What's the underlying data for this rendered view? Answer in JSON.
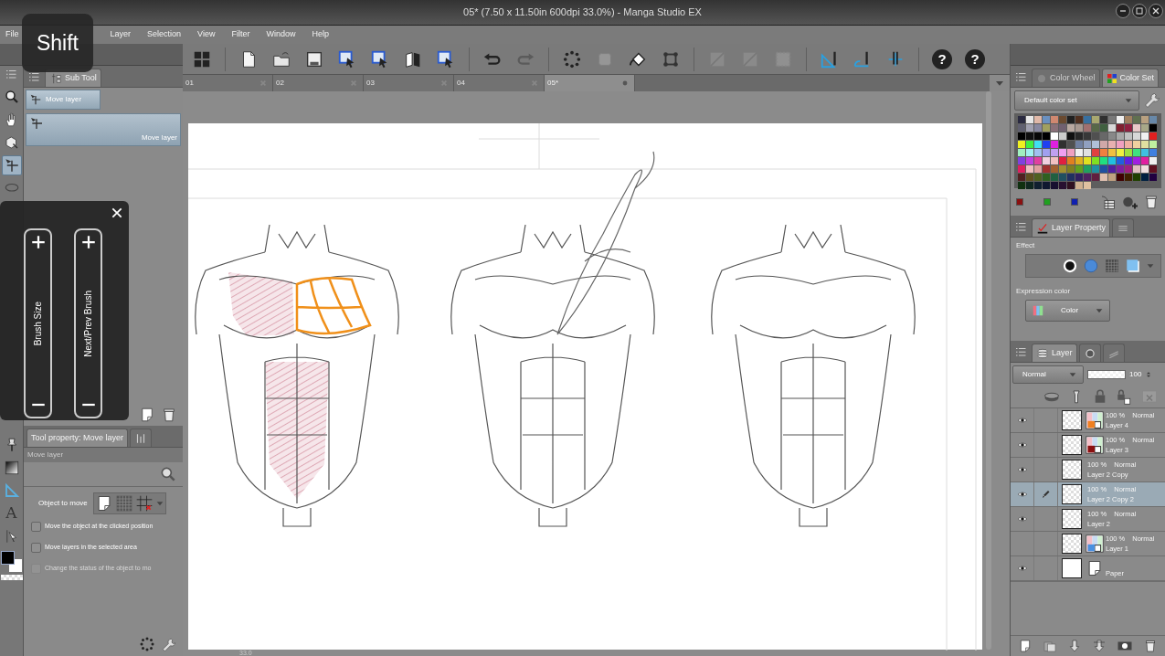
{
  "window": {
    "title": "05* (7.50 x 11.50in 600dpi 33.0%) - Manga Studio EX"
  },
  "key_overlay": {
    "label": "Shift"
  },
  "menu": [
    "File",
    "Layer",
    "Selection",
    "View",
    "Filter",
    "Window",
    "Help"
  ],
  "toolbar": [
    {
      "kind": "grid",
      "disabled": false
    },
    {
      "kind": "separator"
    },
    {
      "kind": "new",
      "disabled": false
    },
    {
      "kind": "open",
      "disabled": false
    },
    {
      "kind": "save",
      "disabled": false
    },
    {
      "kind": "export",
      "disabled": false
    },
    {
      "kind": "export",
      "disabled": false
    },
    {
      "kind": "book",
      "disabled": false
    },
    {
      "kind": "export",
      "disabled": false
    },
    {
      "kind": "separator"
    },
    {
      "kind": "undo",
      "disabled": false
    },
    {
      "kind": "redo",
      "disabled": true
    },
    {
      "kind": "separator"
    },
    {
      "kind": "dots",
      "disabled": false
    },
    {
      "kind": "block",
      "disabled": true
    },
    {
      "kind": "bucket",
      "disabled": false
    },
    {
      "kind": "transform",
      "disabled": false
    },
    {
      "kind": "separator"
    },
    {
      "kind": "slash",
      "disabled": true
    },
    {
      "kind": "slash",
      "disabled": true
    },
    {
      "kind": "frame",
      "disabled": true
    },
    {
      "kind": "separator"
    },
    {
      "kind": "ruler",
      "disabled": false
    },
    {
      "kind": "ruler2",
      "disabled": false
    },
    {
      "kind": "ruler3",
      "disabled": false
    },
    {
      "kind": "separator"
    },
    {
      "kind": "help",
      "label": "?",
      "disabled": false
    },
    {
      "kind": "help",
      "label": "?",
      "disabled": false
    }
  ],
  "doc_tabs": [
    {
      "label": "01",
      "selected": false
    },
    {
      "label": "02",
      "selected": false
    },
    {
      "label": "03",
      "selected": false
    },
    {
      "label": "04",
      "selected": false
    },
    {
      "label": "05*",
      "selected": true
    }
  ],
  "tools": [
    {
      "kind": "zoom",
      "selected": false
    },
    {
      "kind": "hand",
      "selected": false
    },
    {
      "kind": "object",
      "selected": false
    },
    {
      "kind": "move",
      "selected": true
    },
    {
      "kind": "lasso",
      "selected": false
    },
    {
      "kind": "spacer"
    },
    {
      "kind": "pin",
      "selected": false
    },
    {
      "kind": "gradient",
      "selected": false
    },
    {
      "kind": "triangle",
      "selected": false
    },
    {
      "kind": "text",
      "label": "A",
      "selected": false
    },
    {
      "kind": "pointer",
      "selected": false
    }
  ],
  "colors": [
    {
      "kind": "main",
      "color": "#000000"
    },
    {
      "kind": "sub",
      "color": "#ffffff"
    }
  ],
  "sub_tool": {
    "tab": "Sub Tool",
    "groups": [
      {
        "label": "Move layer",
        "selected": true
      }
    ],
    "items": [
      {
        "label": "Move layer",
        "selected": true
      }
    ]
  },
  "brush_overlay": {
    "sliders": [
      {
        "label": "Brush Size"
      },
      {
        "label": "Next/Prev Brush"
      }
    ]
  },
  "tool_property": {
    "tab": "Tool property: Move layer",
    "title": "Move layer",
    "object_label": "Object to move",
    "options": [
      {
        "label": "Move the object at the clicked position",
        "checked": false,
        "disabled": false
      },
      {
        "label": "Move layers in the selected area",
        "checked": false,
        "disabled": false
      },
      {
        "label": "Change the status of the object to mo",
        "checked": false,
        "disabled": true
      }
    ]
  },
  "color_panel": {
    "tabs": [
      {
        "label": "Color Wheel",
        "selected": false
      },
      {
        "label": "Color Set",
        "selected": true
      }
    ],
    "set_name": "Default color set",
    "palette": [
      {
        "color": "#2a2a40"
      },
      {
        "color": "#e8e8e8"
      },
      {
        "color": "#e0b8a8"
      },
      {
        "color": "#6a90c0"
      },
      {
        "color": "#d08870"
      },
      {
        "color": "#6a4a30"
      },
      {
        "color": "#202020"
      },
      {
        "color": "#503020"
      },
      {
        "color": "#3870a0"
      },
      {
        "color": "#a8a870"
      },
      {
        "color": "#303030"
      },
      {
        "color": "#787878"
      },
      {
        "color": "#f0f0f0"
      },
      {
        "color": "#a08060"
      },
      {
        "color": "#607050"
      },
      {
        "color": "#b8a080"
      },
      {
        "color": "#6888a8"
      },
      {
        "color": "#606070"
      },
      {
        "color": "#a0a0b0"
      },
      {
        "color": "#8888a0"
      },
      {
        "color": "#a0a060"
      },
      {
        "color": "#8a7078"
      },
      {
        "color": "#706070"
      },
      {
        "color": "#b8a8a0"
      },
      {
        "color": "#a89890"
      },
      {
        "color": "#a07070"
      },
      {
        "color": "#586848"
      },
      {
        "color": "#406040"
      },
      {
        "color": "#d8d8d8"
      },
      {
        "color": "#802030"
      },
      {
        "color": "#902040"
      },
      {
        "color": "#e8c8c8"
      },
      {
        "color": "#a8a888"
      },
      {
        "color": "#000000"
      },
      {
        "color": "#000000"
      },
      {
        "color": "#101010"
      },
      {
        "color": "#080808"
      },
      {
        "color": "#000000"
      },
      {
        "color": "#ffffff"
      },
      {
        "color": "#cccccc"
      },
      {
        "color": "#101010"
      },
      {
        "color": "#282828"
      },
      {
        "color": "#383838"
      },
      {
        "color": "#505050"
      },
      {
        "color": "#686868"
      },
      {
        "color": "#888888"
      },
      {
        "color": "#a8a8a8"
      },
      {
        "color": "#c0c0c0"
      },
      {
        "color": "#d8d8d8"
      },
      {
        "color": "#f0f0f0"
      },
      {
        "color": "#e02020"
      },
      {
        "color": "#f0f020"
      },
      {
        "color": "#40f040"
      },
      {
        "color": "#40e0f0"
      },
      {
        "color": "#2040f0"
      },
      {
        "color": "#e020e0"
      },
      {
        "color": "#303030"
      },
      {
        "color": "#505050"
      },
      {
        "color": "#7080a0"
      },
      {
        "color": "#90a0c0"
      },
      {
        "color": "#b0c0d8"
      },
      {
        "color": "#d0a8a8"
      },
      {
        "color": "#e8b0b0"
      },
      {
        "color": "#f0a0c0"
      },
      {
        "color": "#f0b0a0"
      },
      {
        "color": "#f0d0a0"
      },
      {
        "color": "#e0e0a0"
      },
      {
        "color": "#c0f0a0"
      },
      {
        "color": "#a0f0c0"
      },
      {
        "color": "#a0f0f0"
      },
      {
        "color": "#a0c0f0"
      },
      {
        "color": "#a0a0f0"
      },
      {
        "color": "#c0a0f0"
      },
      {
        "color": "#f0a0f0"
      },
      {
        "color": "#f0a0c0"
      },
      {
        "color": "#f0f0f0"
      },
      {
        "color": "#e0e0e0"
      },
      {
        "color": "#e04040"
      },
      {
        "color": "#f08040"
      },
      {
        "color": "#f0c040"
      },
      {
        "color": "#f0f040"
      },
      {
        "color": "#a0e040"
      },
      {
        "color": "#40e080"
      },
      {
        "color": "#40c0e0"
      },
      {
        "color": "#4080e0"
      },
      {
        "color": "#8040e0"
      },
      {
        "color": "#c040e0"
      },
      {
        "color": "#e040a0"
      },
      {
        "color": "#f0d0e0"
      },
      {
        "color": "#f0c0c0"
      },
      {
        "color": "#e02040"
      },
      {
        "color": "#e08020"
      },
      {
        "color": "#e0b020"
      },
      {
        "color": "#e0e020"
      },
      {
        "color": "#80e020"
      },
      {
        "color": "#20e080"
      },
      {
        "color": "#20c0e0"
      },
      {
        "color": "#2060e0"
      },
      {
        "color": "#6020e0"
      },
      {
        "color": "#a020e0"
      },
      {
        "color": "#e020a0"
      },
      {
        "color": "#f0f0f0"
      },
      {
        "color": "#e02060"
      },
      {
        "color": "#f0c0c0"
      },
      {
        "color": "#e0a0a0"
      },
      {
        "color": "#a03030"
      },
      {
        "color": "#a06030"
      },
      {
        "color": "#a09030"
      },
      {
        "color": "#808020"
      },
      {
        "color": "#60a020"
      },
      {
        "color": "#20a060"
      },
      {
        "color": "#2090a0"
      },
      {
        "color": "#2050a0"
      },
      {
        "color": "#5020a0"
      },
      {
        "color": "#8020a0"
      },
      {
        "color": "#a02080"
      },
      {
        "color": "#e0c0c0"
      },
      {
        "color": "#f0e0e0"
      },
      {
        "color": "#601020"
      },
      {
        "color": "#502020"
      },
      {
        "color": "#605020"
      },
      {
        "color": "#506020"
      },
      {
        "color": "#306020"
      },
      {
        "color": "#206040"
      },
      {
        "color": "#205060"
      },
      {
        "color": "#203060"
      },
      {
        "color": "#302060"
      },
      {
        "color": "#502060"
      },
      {
        "color": "#602040"
      },
      {
        "color": "#e0c0b0"
      },
      {
        "color": "#c0a080"
      },
      {
        "color": "#400000"
      },
      {
        "color": "#402000"
      },
      {
        "color": "#204000"
      },
      {
        "color": "#002040"
      },
      {
        "color": "#200040"
      },
      {
        "color": "#103010"
      },
      {
        "color": "#102820"
      },
      {
        "color": "#102030"
      },
      {
        "color": "#101830"
      },
      {
        "color": "#181030"
      },
      {
        "color": "#281030"
      },
      {
        "color": "#301020"
      },
      {
        "color": "#d0b090"
      },
      {
        "color": "#e0c0a0"
      }
    ],
    "recent": [
      {
        "color": "#8a1010"
      },
      {
        "color": "#20a020"
      },
      {
        "color": "#1020b0"
      }
    ]
  },
  "layer_property": {
    "tabs": [
      {
        "label": "Layer Property",
        "selected": true
      }
    ],
    "effect_label": "Effect",
    "expression_label": "Expression color",
    "expression_value": "Color"
  },
  "layers_panel": {
    "tab": "Layer",
    "blend": "Normal",
    "opacity": "100",
    "level": 1,
    "layers": [
      {
        "kind": "color",
        "name": "Layer 4",
        "opacity": "100 %",
        "blend": "Normal",
        "visible": true,
        "editing": false,
        "selected": false,
        "color": "#f08020"
      },
      {
        "kind": "color",
        "name": "Layer 3",
        "opacity": "100 %",
        "blend": "Normal",
        "visible": true,
        "editing": false,
        "selected": false,
        "color": "#8a1010"
      },
      {
        "kind": "raster",
        "name": "Layer 2 Copy",
        "opacity": "100 %",
        "blend": "Normal",
        "visible": true,
        "editing": false,
        "selected": false
      },
      {
        "kind": "raster",
        "name": "Layer 2 Copy 2",
        "opacity": "100 %",
        "blend": "Normal",
        "visible": true,
        "editing": true,
        "selected": true
      },
      {
        "kind": "raster",
        "name": "Layer 2",
        "opacity": "100 %",
        "blend": "Normal",
        "visible": true,
        "editing": false,
        "selected": false
      },
      {
        "kind": "color",
        "name": "Layer 1",
        "opacity": "100 %",
        "blend": "Normal",
        "visible": false,
        "editing": false,
        "selected": false,
        "color": "#4a90e0"
      },
      {
        "kind": "paper",
        "name": "Paper",
        "visible": true,
        "editing": false,
        "selected": false
      }
    ]
  },
  "status": {
    "zoom": "33.0"
  }
}
